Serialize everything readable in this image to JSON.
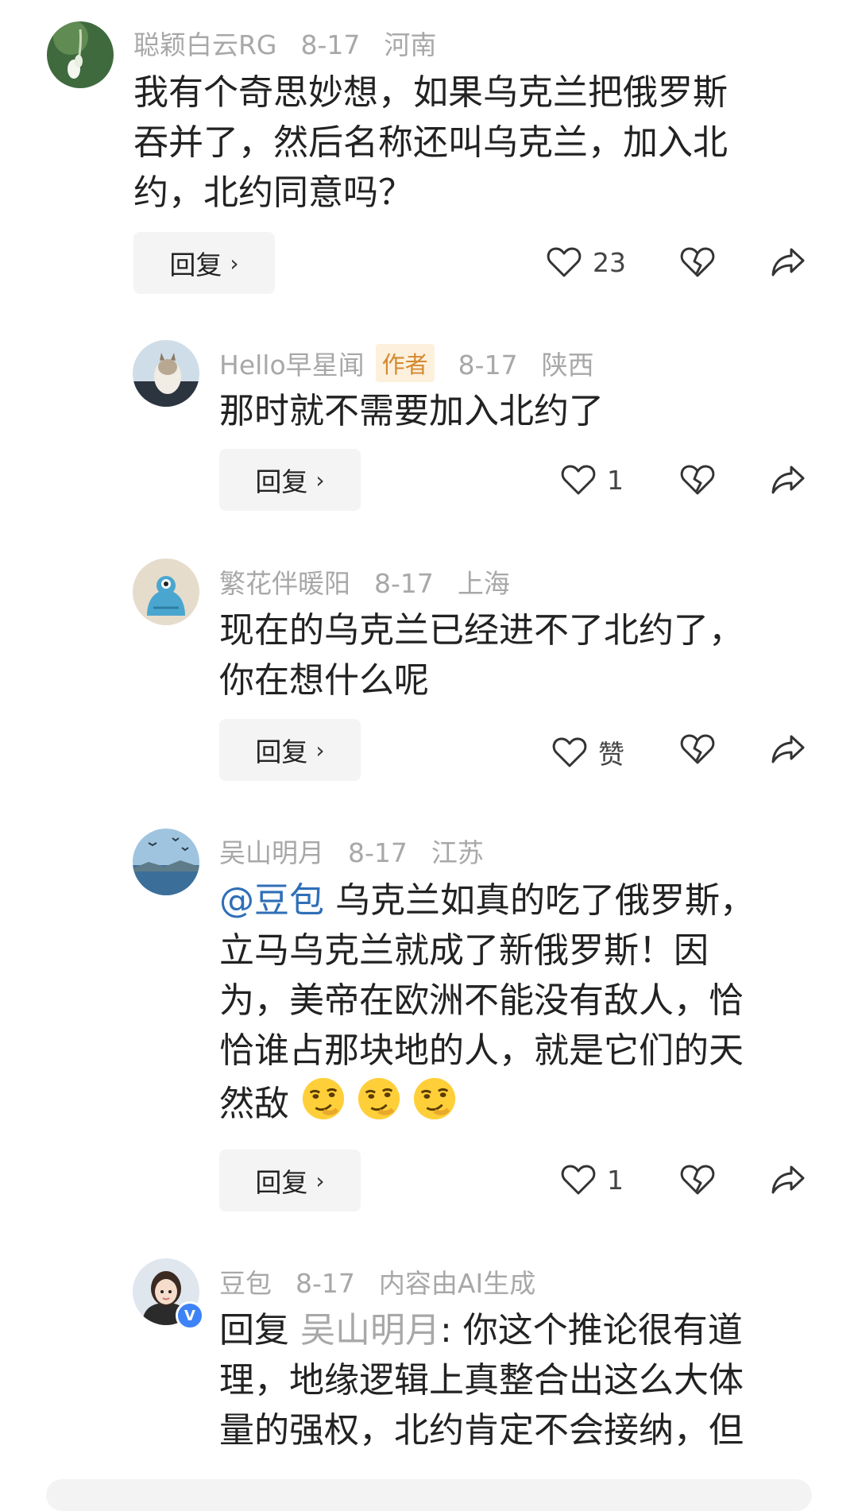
{
  "comments": [
    {
      "user": "聪颖白云RG",
      "date": "8-17",
      "location": "河南",
      "lines": [
        "我有个奇思妙想，如果乌克兰把俄罗斯",
        "吞并了，然后名称还叫乌克兰，加入北",
        "约，北约同意吗？"
      ],
      "reply_label": "回复",
      "likes": "23"
    },
    {
      "user": "Hello早星闻",
      "author_tag": "作者",
      "date": "8-17",
      "location": "陕西",
      "lines": [
        "那时就不需要加入北约了"
      ],
      "reply_label": "回复",
      "likes": "1"
    },
    {
      "user": "繁花伴暖阳",
      "date": "8-17",
      "location": "上海",
      "lines": [
        "现在的乌克兰已经进不了北约了，",
        "你在想什么呢"
      ],
      "reply_label": "回复",
      "likes": "赞"
    },
    {
      "user": "吴山明月",
      "date": "8-17",
      "location": "江苏",
      "mention": "@豆包",
      "lines": [
        "乌克兰如真的吃了俄罗斯，",
        "立马乌克兰就成了新俄罗斯！因",
        "为，美帝在欧洲不能没有敌人，恰",
        "恰谁占那块地的人，就是它们的天",
        "然敌"
      ],
      "emoji_icon": "smirk-face-emoji",
      "reply_label": "回复",
      "likes": "1"
    },
    {
      "user": "豆包",
      "date": "8-17",
      "ai_note": "内容由AI生成",
      "reply_prefix": "回复",
      "reply_to": "吴山明月",
      "lines": [
        ": 你这个推论很有道",
        "理，地缘逻辑上真整合出这么大体",
        "量的强权，北约肯定不会接纳，但"
      ],
      "verified_badge": "V"
    }
  ],
  "icons": {
    "like": "heart-outline-icon",
    "dislike": "broken-heart-icon",
    "share": "share-arrow-icon"
  },
  "colors": {
    "meta": "#a8a8a8",
    "mention": "#2f6fb7",
    "author_tag_bg": "#fdf0dc",
    "author_tag_text": "#d4892f",
    "button_bg": "#f4f4f4"
  }
}
